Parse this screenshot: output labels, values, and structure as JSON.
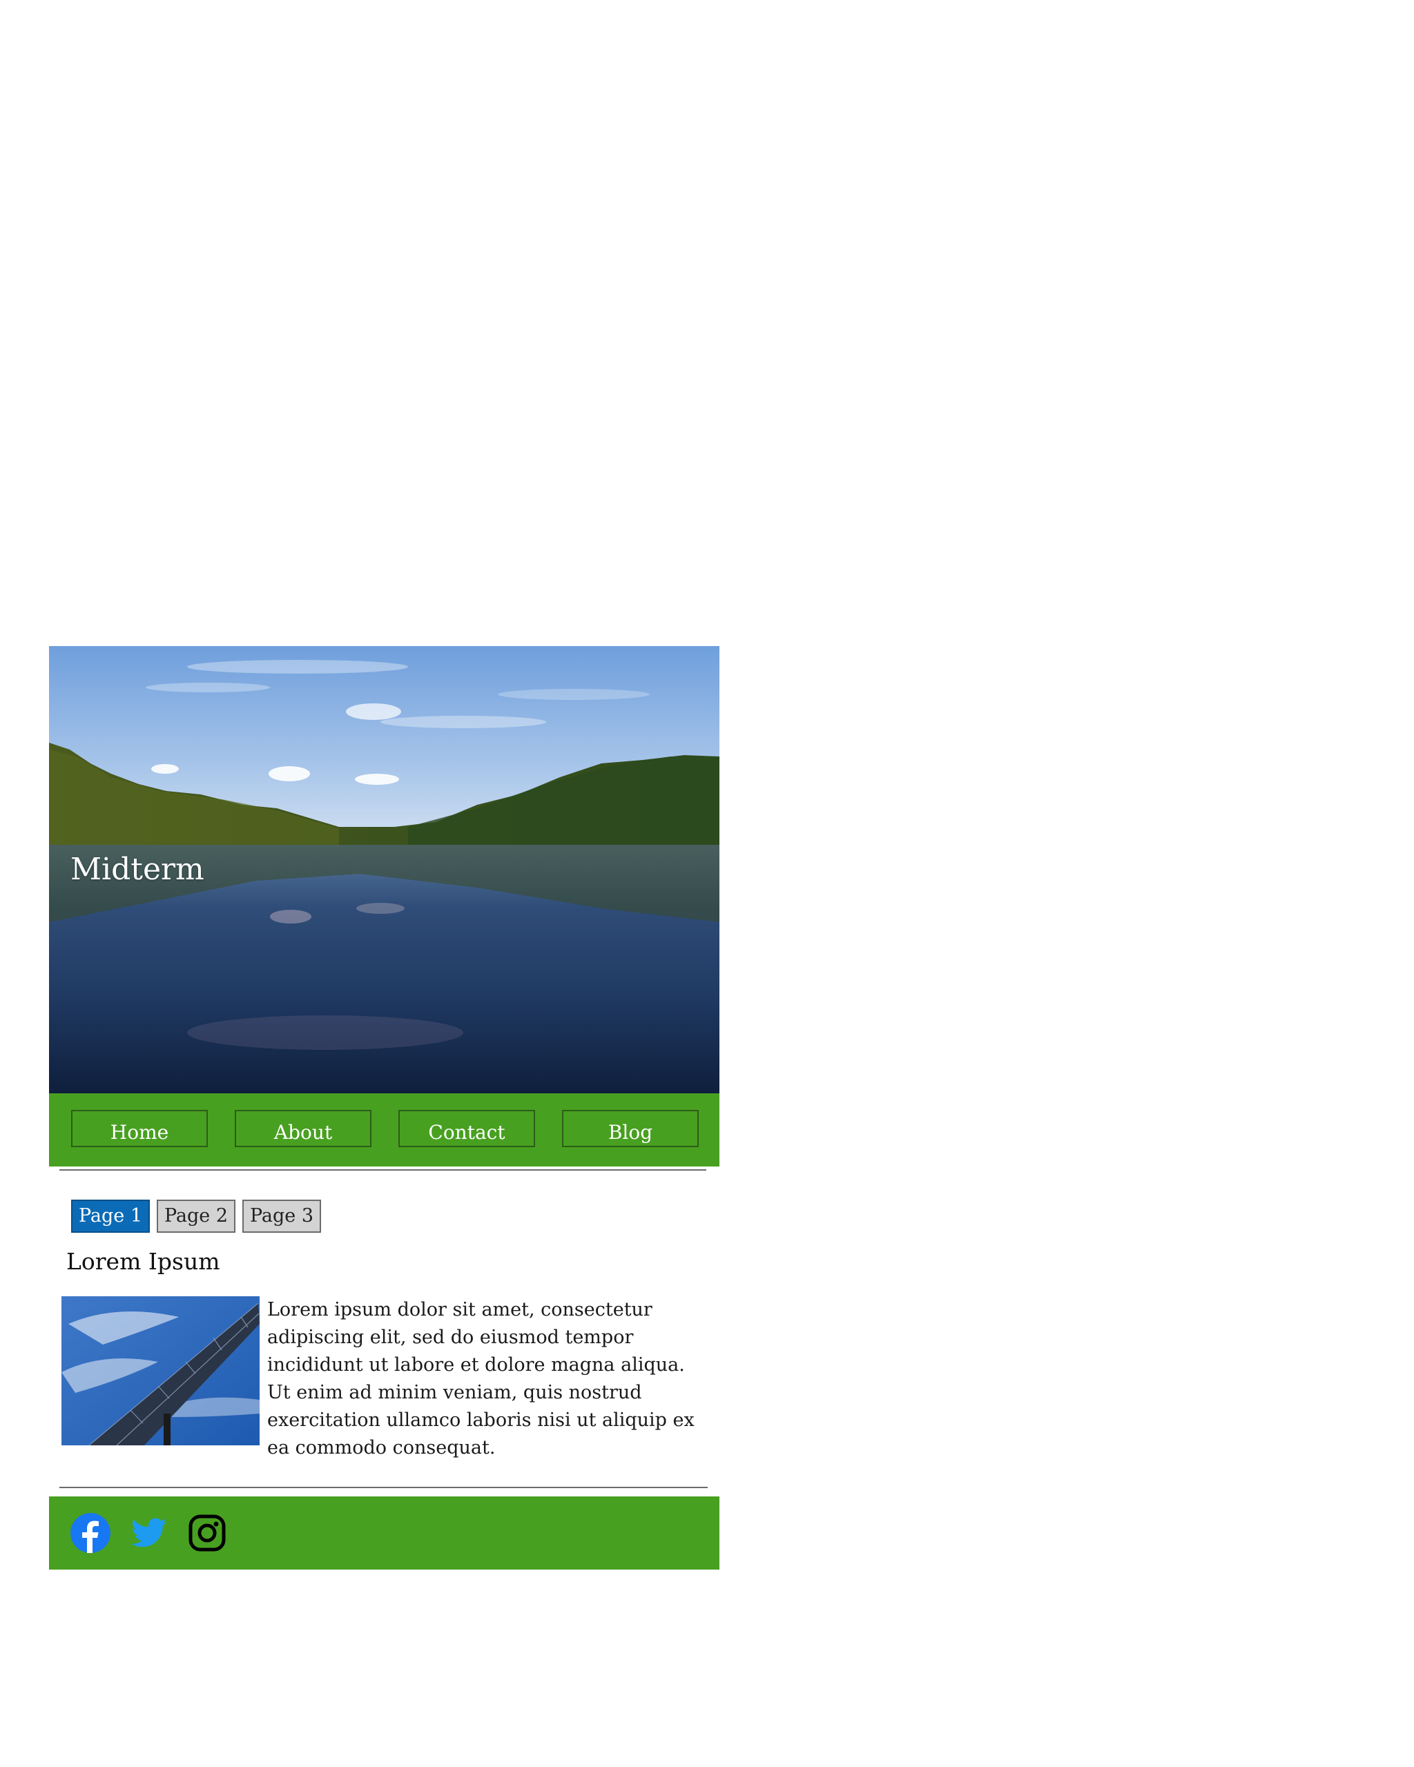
{
  "site": {
    "title": "Midterm"
  },
  "nav": {
    "items": [
      {
        "label": "Home"
      },
      {
        "label": "About"
      },
      {
        "label": "Contact"
      },
      {
        "label": "Blog"
      }
    ]
  },
  "pager": {
    "pages": [
      {
        "label": "Page 1",
        "active": true
      },
      {
        "label": "Page 2",
        "active": false
      },
      {
        "label": "Page 3",
        "active": false
      }
    ]
  },
  "article": {
    "title": "Lorem Ipsum",
    "image": "solar-panel-photo",
    "body": "Lorem ipsum dolor sit amet, consectetur adipiscing elit, sed do eiusmod tempor incididunt ut labore et dolore magna aliqua. Ut enim ad minim veniam, quis nostrud exercitation ullamco laboris nisi ut aliquip ex ea commodo consequat."
  },
  "hero": {
    "image": "lake-forest-photo"
  },
  "footer": {
    "social": [
      {
        "icon": "facebook-icon",
        "color": "#1877f2"
      },
      {
        "icon": "twitter-icon",
        "color": "#1d9bf0"
      },
      {
        "icon": "instagram-icon",
        "color": "#000000"
      }
    ]
  },
  "colors": {
    "brand_green": "#48a020",
    "active_page": "#0b6bb7",
    "inactive_page": "#d3d3d3"
  }
}
